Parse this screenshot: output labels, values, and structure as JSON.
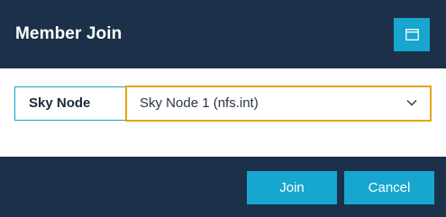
{
  "dialog": {
    "title": "Member Join",
    "maximize_icon": "maximize-window-icon"
  },
  "form": {
    "label": "Sky Node",
    "select_value": "Sky Node 1 (nfs.int)",
    "chevron_icon": "chevron-down-icon"
  },
  "actions": {
    "join_label": "Join",
    "cancel_label": "Cancel"
  },
  "colors": {
    "header_bg": "#1c3049",
    "accent": "#16a6cf",
    "focus_border": "#e8a317"
  }
}
